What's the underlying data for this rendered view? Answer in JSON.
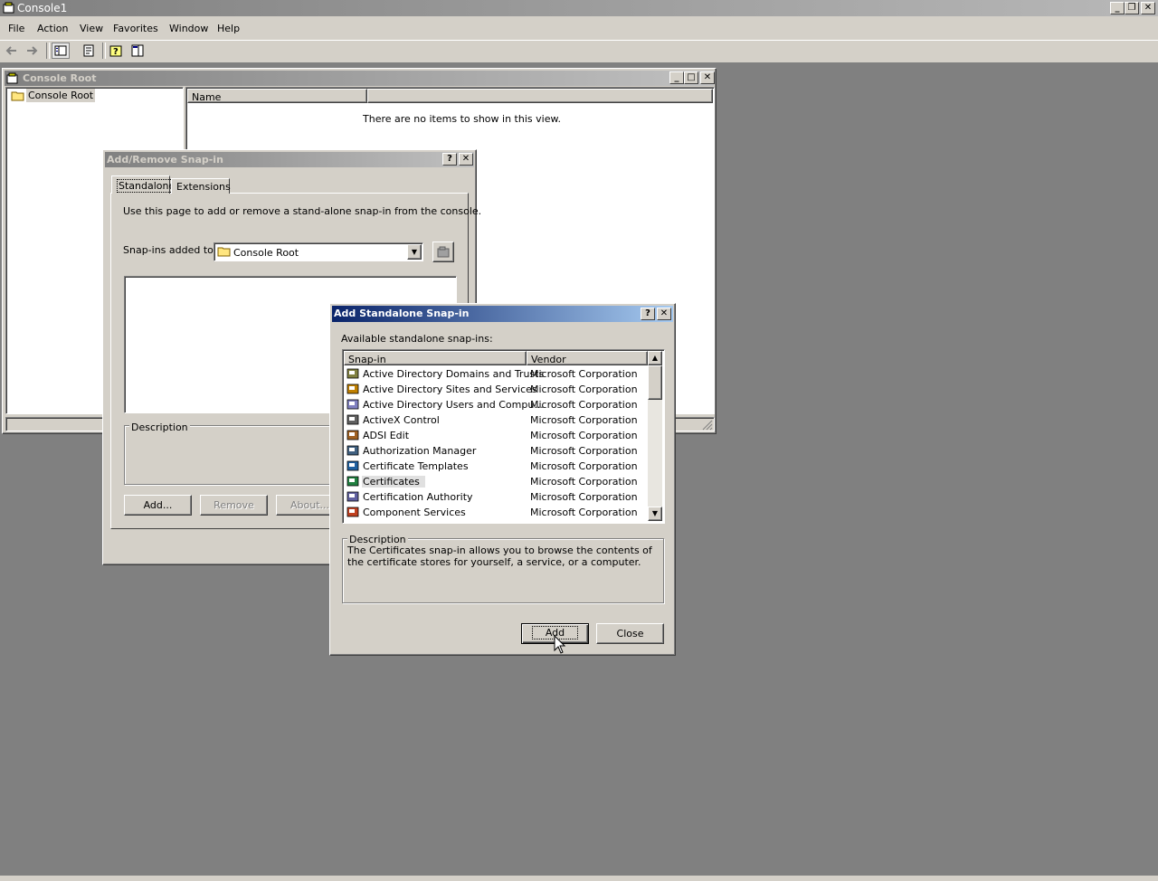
{
  "app": {
    "title": "Console1",
    "menu": [
      "File",
      "Action",
      "View",
      "Favorites",
      "Window",
      "Help"
    ]
  },
  "console_root_window": {
    "title": "Console Root",
    "tree_item": "Console Root",
    "list_column": "Name",
    "empty_message": "There are no items to show in this view."
  },
  "add_remove_dialog": {
    "title": "Add/Remove Snap-in",
    "tabs": [
      "Standalone",
      "Extensions"
    ],
    "intro": "Use this page to add or remove a stand-alone snap-in from the console.",
    "snapins_added_label": "Snap-ins added to:",
    "snapins_added_value": "Console Root",
    "description_label": "Description",
    "buttons": {
      "add": "Add...",
      "remove": "Remove",
      "about": "About..."
    }
  },
  "standalone_dialog": {
    "title": "Add Standalone Snap-in",
    "available_label": "Available standalone snap-ins:",
    "columns": {
      "snapin": "Snap-in",
      "vendor": "Vendor"
    },
    "rows": [
      {
        "name": "Active Directory Domains and Trusts",
        "vendor": "Microsoft Corporation",
        "icon": "ad-domains-icon"
      },
      {
        "name": "Active Directory Sites and Services",
        "vendor": "Microsoft Corporation",
        "icon": "ad-sites-icon"
      },
      {
        "name": "Active Directory Users and Compu...",
        "vendor": "Microsoft Corporation",
        "icon": "ad-users-icon"
      },
      {
        "name": "ActiveX Control",
        "vendor": "Microsoft Corporation",
        "icon": "activex-icon"
      },
      {
        "name": "ADSI Edit",
        "vendor": "Microsoft Corporation",
        "icon": "adsi-edit-icon"
      },
      {
        "name": "Authorization Manager",
        "vendor": "Microsoft Corporation",
        "icon": "authorization-manager-icon"
      },
      {
        "name": "Certificate Templates",
        "vendor": "Microsoft Corporation",
        "icon": "certificate-templates-icon"
      },
      {
        "name": "Certificates",
        "vendor": "Microsoft Corporation",
        "icon": "certificates-icon",
        "selected": true
      },
      {
        "name": "Certification Authority",
        "vendor": "Microsoft Corporation",
        "icon": "certification-authority-icon"
      },
      {
        "name": "Component Services",
        "vendor": "Microsoft Corporation",
        "icon": "component-services-icon"
      }
    ],
    "description_label": "Description",
    "description_text": "The Certificates snap-in allows you to browse the contents of the certificate stores for yourself, a service, or a computer.",
    "buttons": {
      "add": "Add",
      "close": "Close"
    }
  }
}
